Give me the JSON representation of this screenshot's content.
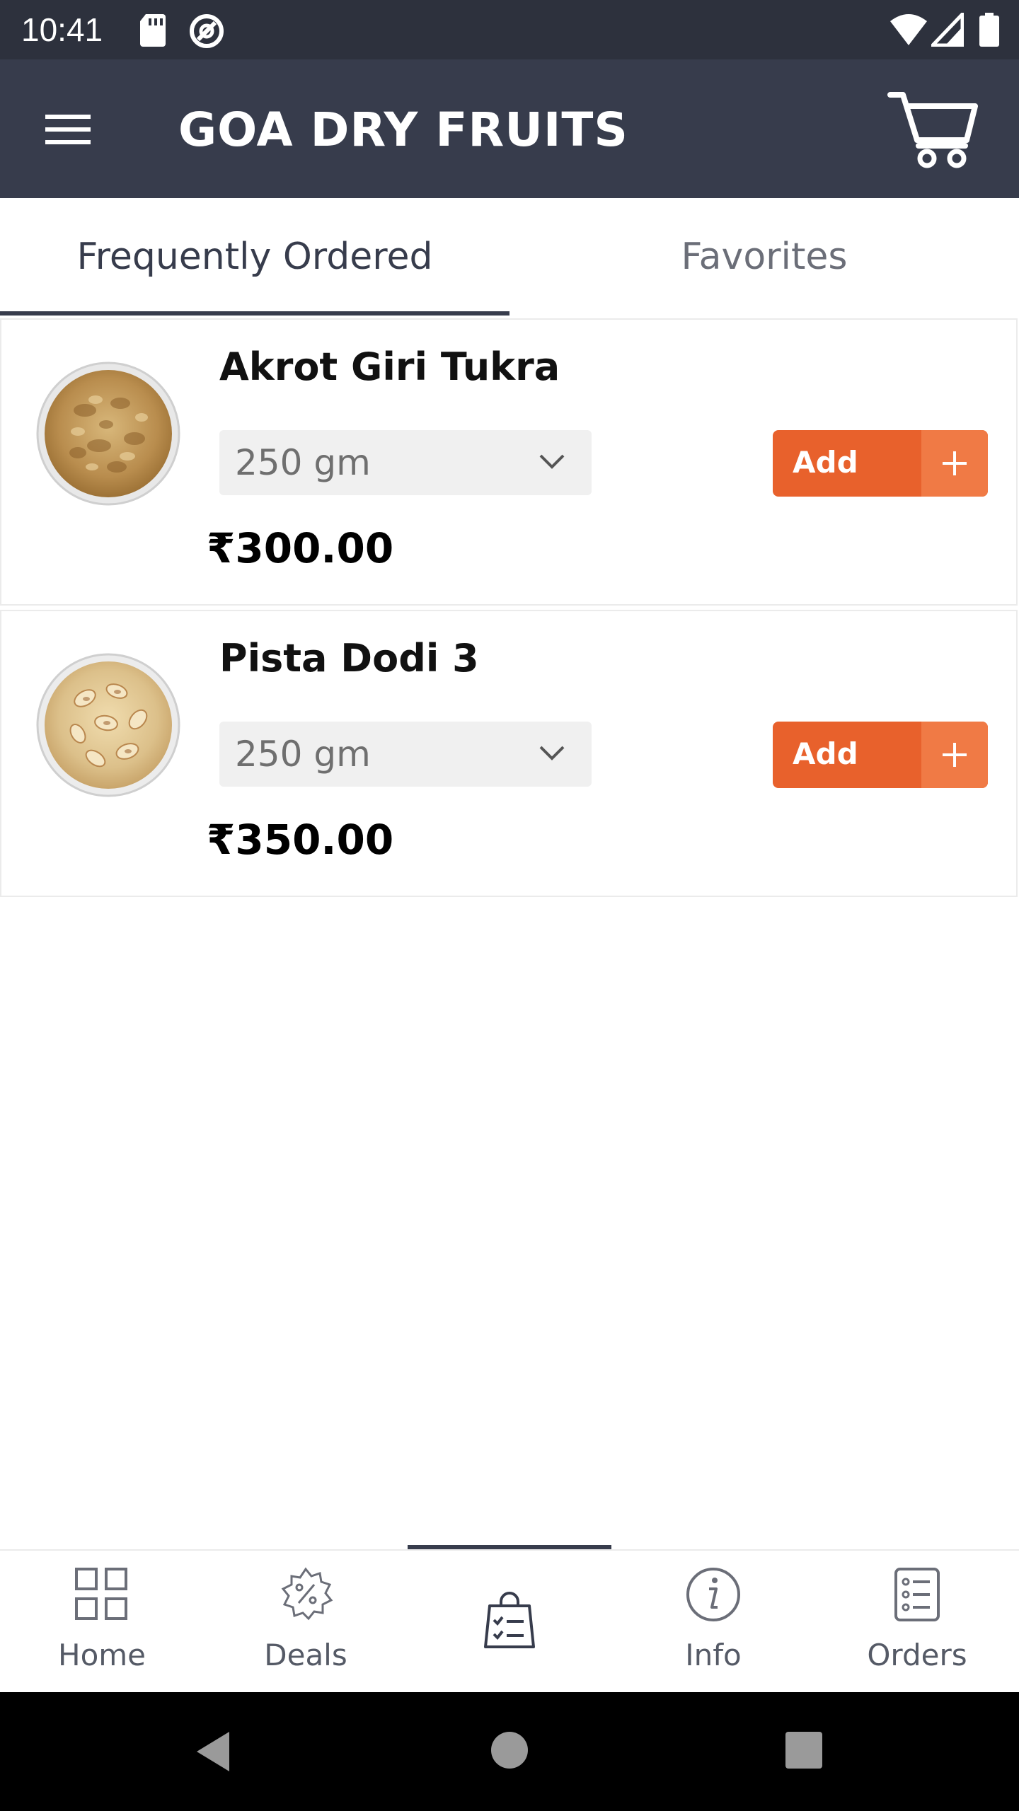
{
  "status_bar": {
    "time": "10:41"
  },
  "app_bar": {
    "title": "GOA DRY FRUITS"
  },
  "tabs": [
    {
      "label": "Frequently Ordered",
      "active": true
    },
    {
      "label": "Favorites",
      "active": false
    }
  ],
  "products": [
    {
      "name": "Akrot Giri Tukra",
      "weight": "250 gm",
      "price": "₹300.00",
      "add_label": "Add",
      "image_icon": "walnut-bowl-image"
    },
    {
      "name": "Pista Dodi 3",
      "weight": "250 gm",
      "price": "₹350.00",
      "add_label": "Add",
      "image_icon": "pistachio-bowl-image"
    }
  ],
  "bottom_nav": [
    {
      "label": "Home",
      "icon": "grid-icon"
    },
    {
      "label": "Deals",
      "icon": "discount-badge-icon"
    },
    {
      "label": "",
      "icon": "shopping-bag-check-icon",
      "active": true
    },
    {
      "label": "Info",
      "icon": "info-icon"
    },
    {
      "label": "Orders",
      "icon": "order-list-icon"
    }
  ],
  "colors": {
    "app_bar": "#373c4c",
    "status_bar": "#2d313d",
    "accent": "#e8612c"
  }
}
